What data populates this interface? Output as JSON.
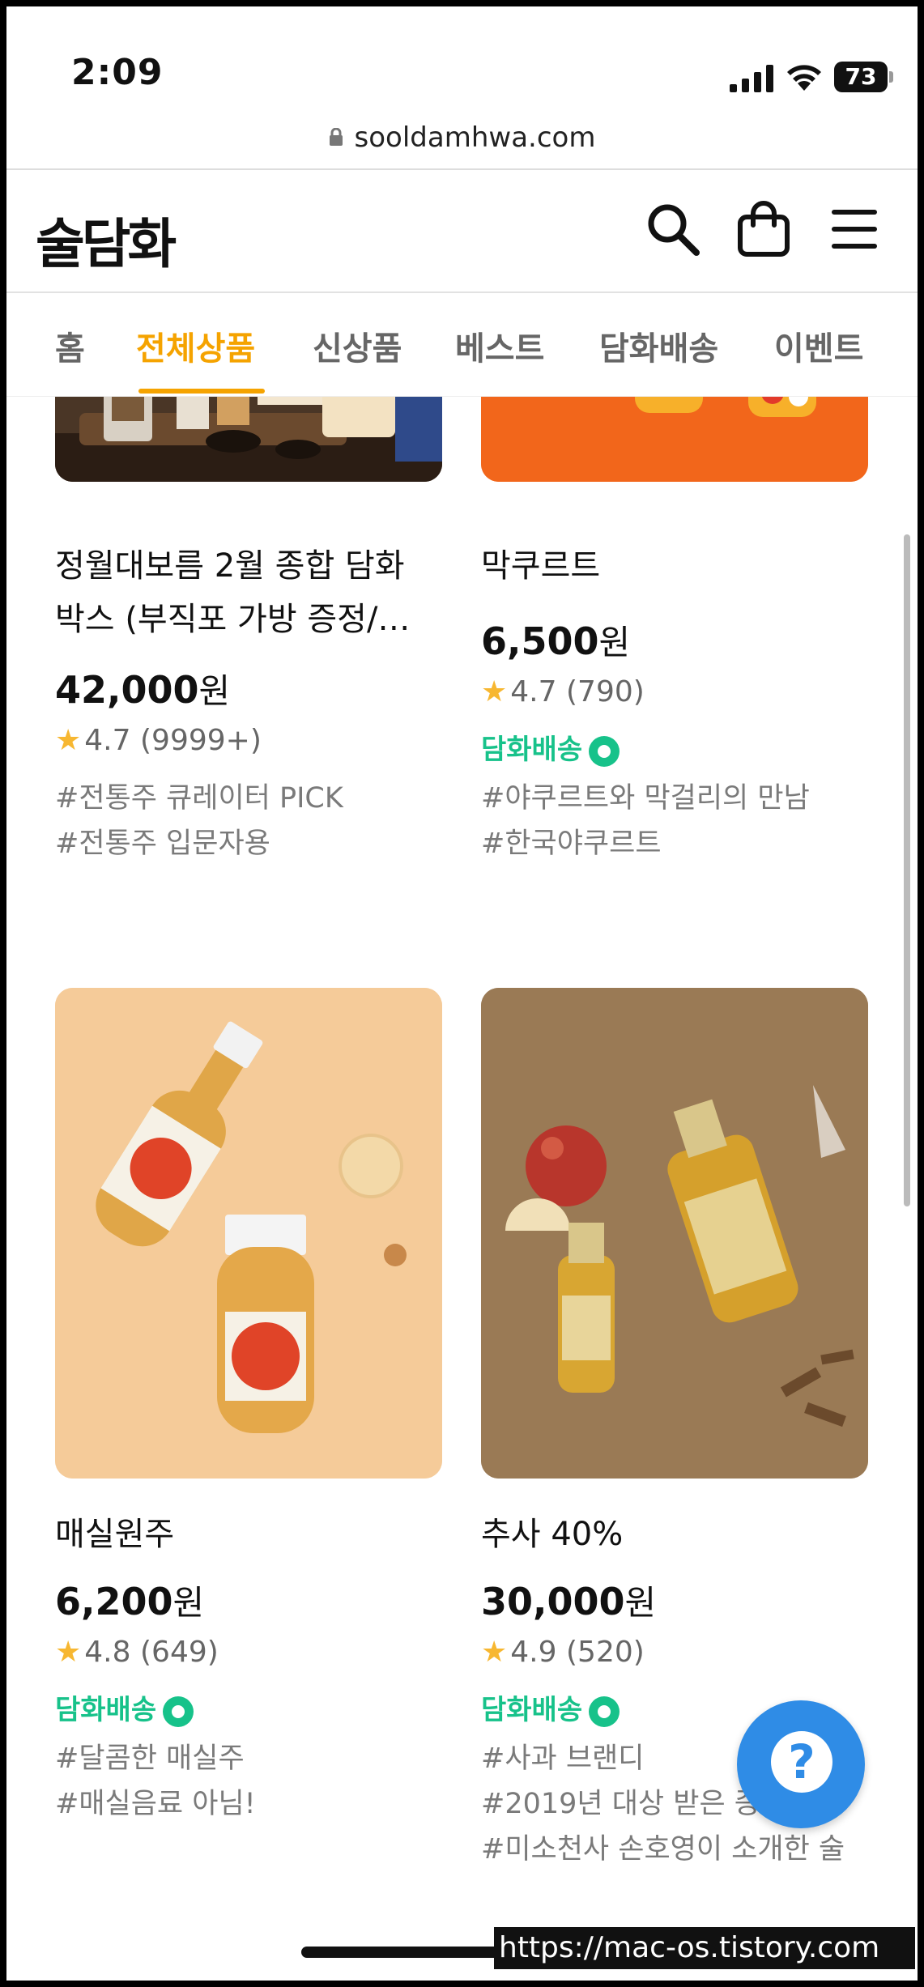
{
  "status_bar": {
    "time": "2:09",
    "battery": "73"
  },
  "browser": {
    "url": "sooldamhwa.com"
  },
  "header": {
    "logo": "술담화"
  },
  "nav": {
    "tabs": [
      {
        "label": "홈"
      },
      {
        "label": "전체상품"
      },
      {
        "label": "신상품"
      },
      {
        "label": "베스트"
      },
      {
        "label": "담화배송"
      },
      {
        "label": "이벤트"
      }
    ],
    "active_index": 1
  },
  "products": [
    {
      "title_line1": "정월대보름 2월 종합 담화",
      "title_line2": "박스 (부직포 가방 증정/…",
      "price": "42,000",
      "currency": "원",
      "rating": "4.7",
      "reviews": "(9999+)",
      "delivery": "",
      "tags": [
        "#전통주 큐레이터 PICK",
        "#전통주 입문자용"
      ]
    },
    {
      "title_line1": "막쿠르트",
      "price": "6,500",
      "currency": "원",
      "rating": "4.7",
      "reviews": "(790)",
      "delivery": "담화배송",
      "tags": [
        "#야쿠르트와 막걸리의 만남",
        "#한국야쿠르트"
      ]
    },
    {
      "title_line1": "매실원주",
      "price": "6,200",
      "currency": "원",
      "rating": "4.8",
      "reviews": "(649)",
      "delivery": "담화배송",
      "tags": [
        "#달콤한 매실주",
        "#매실음료 아님!"
      ]
    },
    {
      "title_line1": "추사 40%",
      "price": "30,000",
      "currency": "원",
      "rating": "4.9",
      "reviews": "(520)",
      "delivery": "담화배송",
      "tags": [
        "#사과 브랜디",
        "#2019년 대상 받은 증",
        "#미소천사 손호영이 소개한 술"
      ]
    }
  ],
  "help_button": {
    "label": "?"
  },
  "watermark": "https://mac-os.tistory.com",
  "colors": {
    "accent": "#f5a300",
    "delivery_green": "#17c28a",
    "help_blue": "#2f8ce6"
  }
}
